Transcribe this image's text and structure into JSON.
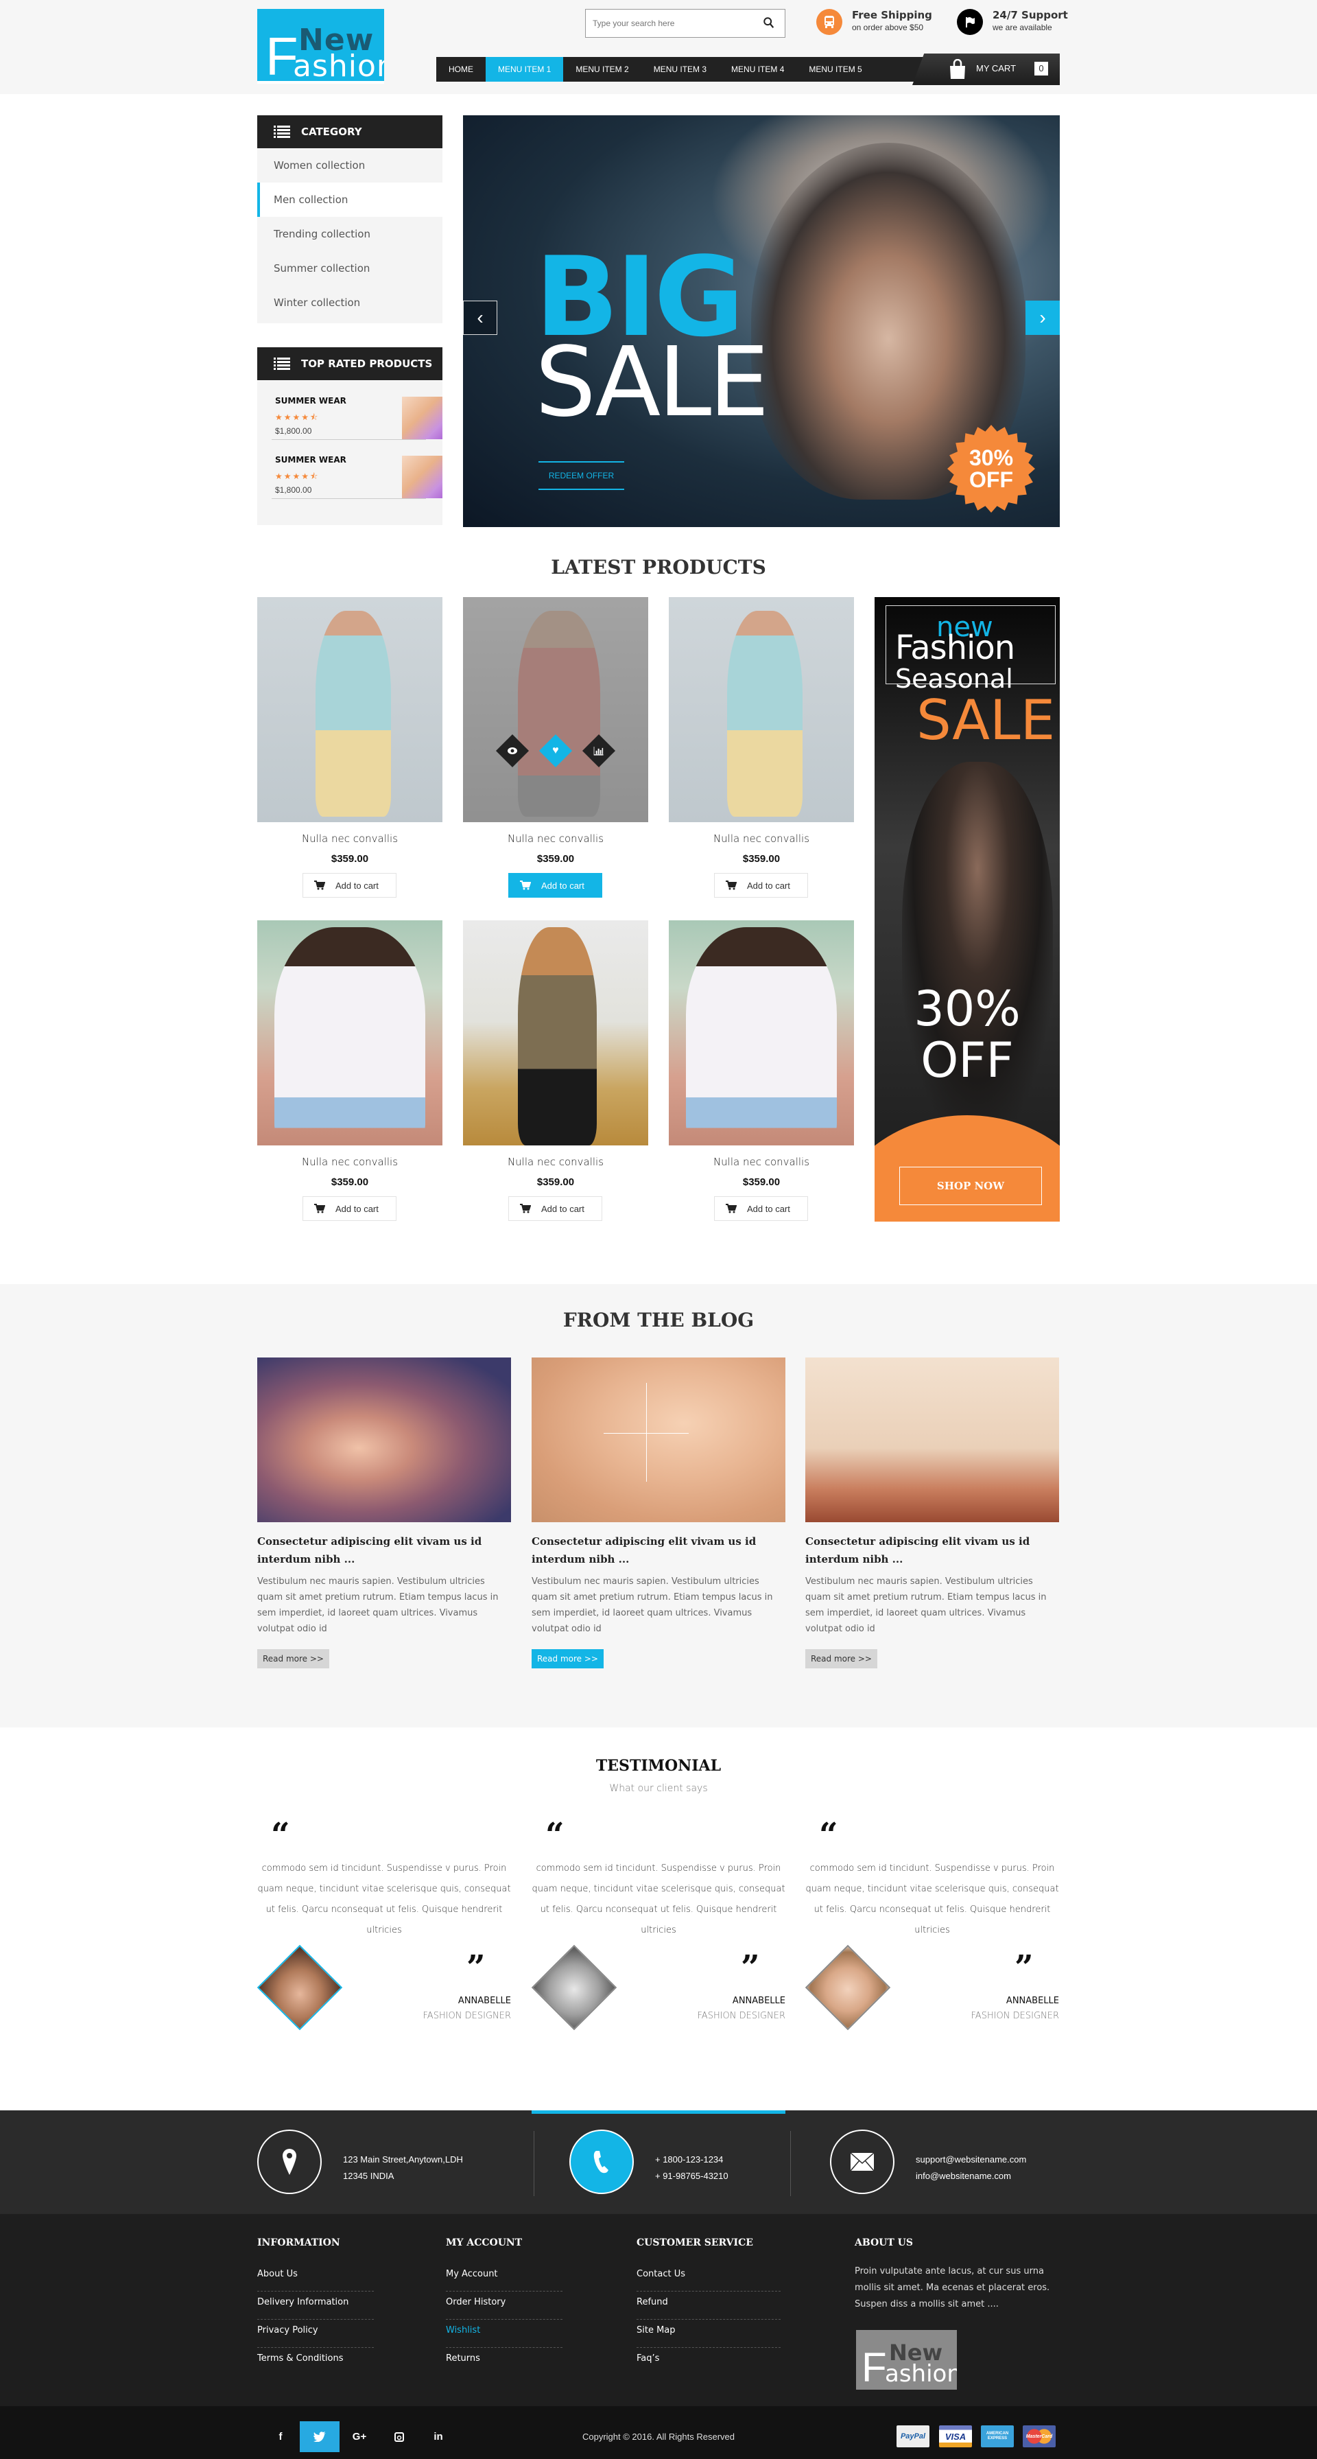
{
  "header": {
    "logo": {
      "top": "New",
      "main_initial": "F",
      "main_rest": "ashion"
    },
    "search": {
      "placeholder": "Type your search here",
      "icon": "search-icon"
    },
    "features": [
      {
        "title": "Free Shipping",
        "subtitle": "on order above $50",
        "icon": "bus-icon",
        "color": "#f5893a"
      },
      {
        "title": "24/7 Support",
        "subtitle": "we are available",
        "icon": "flag-icon",
        "color": "#000000"
      }
    ],
    "nav": [
      {
        "label": "HOME",
        "active": false
      },
      {
        "label": "MENU ITEM 1",
        "active": true
      },
      {
        "label": "MENU ITEM 2",
        "active": false
      },
      {
        "label": "MENU ITEM 3",
        "active": false
      },
      {
        "label": "MENU ITEM 4",
        "active": false
      },
      {
        "label": "MENU ITEM 5",
        "active": false
      }
    ],
    "cart": {
      "label": "MY CART",
      "count": "0",
      "icon": "shopping-bag-icon"
    }
  },
  "sidebar": {
    "category_title": "CATEGORY",
    "categories": [
      {
        "label": "Women collection",
        "active": false
      },
      {
        "label": "Men collection",
        "active": true
      },
      {
        "label": "Trending collection",
        "active": false
      },
      {
        "label": "Summer collection",
        "active": false
      },
      {
        "label": "Winter collection",
        "active": false
      }
    ],
    "top_rated_title": "TOP RATED PRODUCTS",
    "top_rated": [
      {
        "name": "SUMMER WEAR",
        "rating": 4.5,
        "rating_max": 5,
        "price": "$1,800.00"
      },
      {
        "name": "SUMMER WEAR",
        "rating": 4.5,
        "rating_max": 5,
        "price": "$1,800.00"
      }
    ]
  },
  "hero": {
    "line1": "BIG",
    "line2": "SALE",
    "cta": "REDEEM OFFER",
    "badge_line1": "30%",
    "badge_line2": "OFF",
    "prev_icon": "chevron-left-icon",
    "next_icon": "chevron-right-icon"
  },
  "latest": {
    "title": "LATEST PRODUCTS",
    "products": [
      {
        "name": "Nulla nec convallis",
        "price": "$359.00",
        "cta": "Add to cart",
        "highlight": false
      },
      {
        "name": "Nulla nec convallis",
        "price": "$359.00",
        "cta": "Add to cart",
        "highlight": true
      },
      {
        "name": "Nulla nec convallis",
        "price": "$359.00",
        "cta": "Add to cart",
        "highlight": false
      },
      {
        "name": "Nulla nec convallis",
        "price": "$359.00",
        "cta": "Add to cart",
        "highlight": false
      },
      {
        "name": "Nulla nec convallis",
        "price": "$359.00",
        "cta": "Add to cart",
        "highlight": false
      },
      {
        "name": "Nulla nec convallis",
        "price": "$359.00",
        "cta": "Add to cart",
        "highlight": false
      }
    ],
    "hover_actions": [
      "eye-icon",
      "heart-icon",
      "chart-icon"
    ]
  },
  "promo": {
    "new": "new",
    "fashion": "Fashion",
    "seasonal": "Seasonal",
    "sale": "SALE",
    "off1": "30%",
    "off2": "OFF",
    "cta": "SHOP NOW"
  },
  "blog": {
    "title": "FROM THE BLOG",
    "posts": [
      {
        "title": "Consectetur adipiscing elit vivam us id interdum nibh ...",
        "text": "Vestibulum nec mauris sapien. Vestibulum ultricies quam sit amet pretium rutrum. Etiam tempus lacus in sem imperdiet, id laoreet quam ultrices. Vivamus volutpat odio id",
        "cta": "Read more >>",
        "highlight": false
      },
      {
        "title": "Consectetur adipiscing elit vivam us id interdum nibh ...",
        "text": "Vestibulum nec mauris sapien. Vestibulum ultricies quam sit amet pretium rutrum. Etiam tempus lacus in sem imperdiet, id laoreet quam ultrices. Vivamus volutpat odio id",
        "cta": "Read more >>",
        "highlight": true
      },
      {
        "title": "Consectetur adipiscing elit vivam us id interdum nibh ...",
        "text": "Vestibulum nec mauris sapien. Vestibulum ultricies quam sit amet pretium rutrum. Etiam tempus lacus in sem imperdiet, id laoreet quam ultrices. Vivamus volutpat odio id",
        "cta": "Read more >>",
        "highlight": false
      }
    ]
  },
  "testimonial": {
    "title": "TESTIMONIAL",
    "subtitle": "What our client says",
    "open_quote": "“",
    "close_quote": "”",
    "items": [
      {
        "quote": "commodo sem id tincidunt. Suspendisse v purus. Proin quam neque, tincidunt vitae scelerisque quis, consequat ut felis. Qarcu nconsequat ut felis. Quisque hendrerit ultricies",
        "name": "ANNABELLE",
        "role": "FASHION DESIGNER",
        "highlight": true
      },
      {
        "quote": "commodo sem id tincidunt. Suspendisse v purus. Proin quam neque, tincidunt vitae scelerisque quis, consequat ut felis. Qarcu nconsequat ut felis. Quisque hendrerit ultricies",
        "name": "ANNABELLE",
        "role": "FASHION DESIGNER",
        "highlight": false
      },
      {
        "quote": "commodo sem id tincidunt. Suspendisse v purus. Proin quam neque, tincidunt vitae scelerisque quis, consequat ut felis. Qarcu nconsequat ut felis. Quisque hendrerit ultricies",
        "name": "ANNABELLE",
        "role": "FASHION DESIGNER",
        "highlight": false
      }
    ]
  },
  "contact": {
    "address": {
      "line1": "123 Main Street,Anytown,LDH",
      "line2": "12345 INDIA",
      "icon": "map-pin-icon"
    },
    "phone": {
      "line1": "+ 1800-123-1234",
      "line2": "+ 91-98765-43210",
      "icon": "phone-icon"
    },
    "email": {
      "line1": "support@websitename.com",
      "line2": "info@websitename.com",
      "icon": "mail-icon"
    }
  },
  "footer": {
    "columns": [
      {
        "title": "INFORMATION",
        "links": [
          {
            "label": "About Us"
          },
          {
            "label": "Delivery Information"
          },
          {
            "label": "Privacy Policy"
          },
          {
            "label": "Terms & Conditions"
          }
        ]
      },
      {
        "title": "MY ACCOUNT",
        "links": [
          {
            "label": "My Account"
          },
          {
            "label": "Order History"
          },
          {
            "label": "Wishlist",
            "active": true
          },
          {
            "label": "Returns"
          }
        ]
      },
      {
        "title": "CUSTOMER SERVICE",
        "links": [
          {
            "label": "Contact Us"
          },
          {
            "label": "Refund"
          },
          {
            "label": "Site Map"
          },
          {
            "label": "Faq’s"
          }
        ]
      }
    ],
    "about": {
      "title": "ABOUT US",
      "text": "Proin vulputate ante lacus, at cur sus urna mollis sit amet. Ma ecenas et placerat eros. Suspen  diss a mollis sit amet ...."
    },
    "social": [
      {
        "icon": "facebook-icon",
        "glyph": "f"
      },
      {
        "icon": "twitter-icon",
        "glyph": "t",
        "active": true
      },
      {
        "icon": "google-plus-icon",
        "glyph": "G+"
      },
      {
        "icon": "instagram-icon",
        "glyph": "▣"
      },
      {
        "icon": "linkedin-icon",
        "glyph": "in"
      }
    ],
    "copyright": "Copyright © 2016. All Rights Reserved",
    "payments": [
      {
        "label": "PayPal",
        "icon": "paypal-icon"
      },
      {
        "label": "VISA",
        "icon": "visa-icon"
      },
      {
        "label": "AMERICAN EXPRESS",
        "icon": "amex-icon"
      },
      {
        "label": "MasterCard",
        "icon": "mastercard-icon"
      }
    ]
  },
  "colors": {
    "accent": "#13b5e6",
    "orange": "#f5893a",
    "dark": "#222222"
  }
}
